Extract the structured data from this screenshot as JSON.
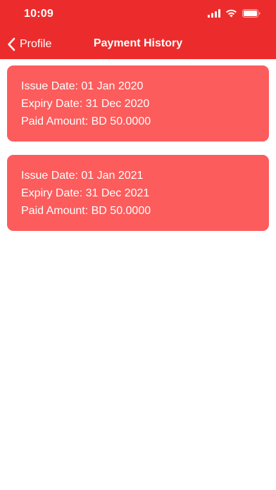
{
  "status_bar": {
    "time": "10:09"
  },
  "nav": {
    "back_label": "Profile",
    "title": "Payment History"
  },
  "colors": {
    "header_background": "#ec2c2c",
    "card_background": "#fd5c5c",
    "text": "#ffffff"
  },
  "payments": [
    {
      "issue_date": "Issue Date: 01 Jan 2020",
      "expiry_date": "Expiry Date: 31 Dec 2020",
      "paid_amount": "Paid Amount: BD 50.0000"
    },
    {
      "issue_date": "Issue Date: 01 Jan 2021",
      "expiry_date": "Expiry Date: 31 Dec 2021",
      "paid_amount": "Paid Amount: BD 50.0000"
    }
  ]
}
